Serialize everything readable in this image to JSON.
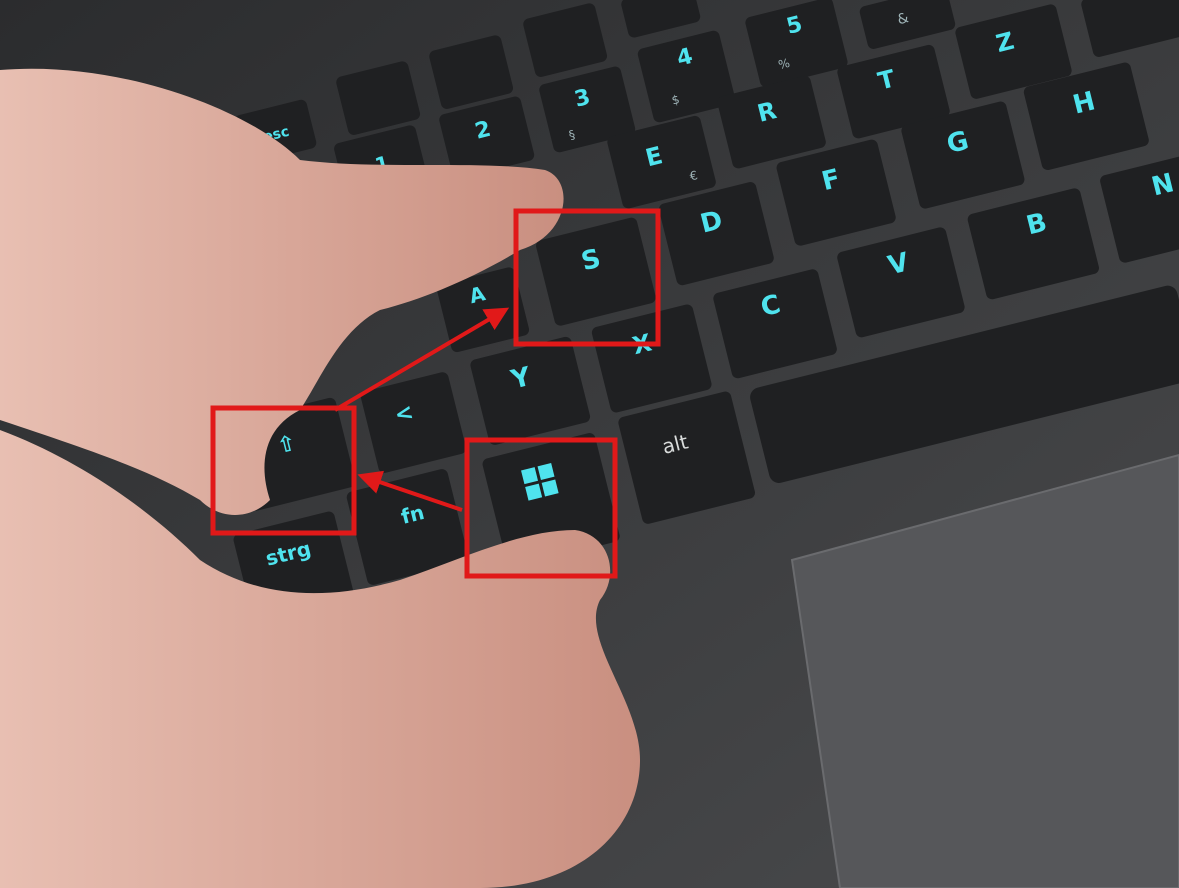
{
  "photo": {
    "subject": "hand pressing keyboard shortcut on backlit laptop keyboard",
    "colors": {
      "backlight": "#4fe3ee",
      "highlight_box": "#e11919",
      "deck": "#3a3b3d",
      "key": "#1f2022",
      "skin": "#d9a89a"
    }
  },
  "keys": {
    "esc": "esc",
    "one": "1",
    "two": "2",
    "three": "3",
    "four": "4",
    "five": "5",
    "amp": "&",
    "pct": "%",
    "dollar": "$",
    "section": "§",
    "z": "Z",
    "t": "T",
    "r": "R",
    "e": "E",
    "euro": "€",
    "h": "H",
    "g": "G",
    "f": "F",
    "d": "D",
    "s": "S",
    "a": "A",
    "n": "N",
    "b": "B",
    "v": "V",
    "c": "C",
    "x": "X",
    "y": "Y",
    "lt": "<",
    "shift_glyph": "⇧",
    "alt": "alt",
    "fn": "fn",
    "strg": "strg"
  },
  "annotations": {
    "highlighted_keys": [
      "shift",
      "windows",
      "s"
    ],
    "arrows": [
      "windows→shift",
      "shift→s"
    ]
  }
}
